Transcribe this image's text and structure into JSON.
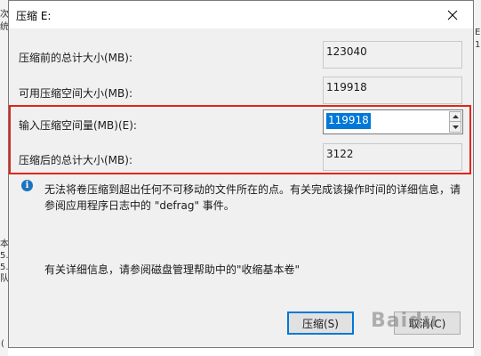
{
  "background": {
    "fragments_left": [
      "次",
      "统",
      "本",
      "5.",
      "5.",
      "队"
    ],
    "fragments_right": [
      "E",
      "1"
    ],
    "fragment_bottom_left": "("
  },
  "dialog": {
    "title": "压缩 E:",
    "rows": [
      {
        "label": "压缩前的总计大小(MB):",
        "value": "123040"
      },
      {
        "label": "可用压缩空间大小(MB):",
        "value": "119918"
      },
      {
        "label": "输入压缩空间量(MB)(E):",
        "value": "119918"
      },
      {
        "label": "压缩后的总计大小(MB):",
        "value": "3122"
      }
    ],
    "info_text": "无法将卷压缩到超出任何不可移动的文件所在的点。有关完成该操作时间的详细信息，请参阅应用程序日志中的 \"defrag\" 事件。",
    "more_info": "有关详细信息，请参阅磁盘管理帮助中的\"收缩基本卷\"",
    "buttons": {
      "shrink": "压缩(S)",
      "cancel": "取消(C)"
    },
    "watermark": "Baidu",
    "highlight_color": "#e4231c",
    "accent_color": "#0078d7"
  }
}
